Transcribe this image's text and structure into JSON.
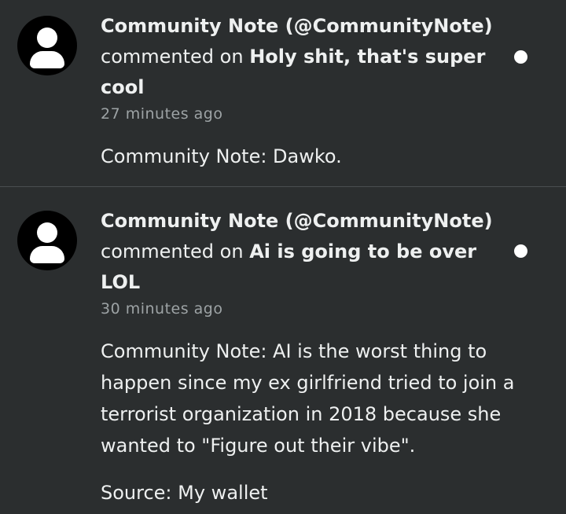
{
  "notifications": [
    {
      "author": "Community Note (@CommunityNote)",
      "action": "commented on",
      "post_title": "Holy shit, that's super cool",
      "timestamp": "27 minutes ago",
      "body": "Community Note: Dawko.",
      "unread": true
    },
    {
      "author": "Community Note (@CommunityNote)",
      "action": "commented on",
      "post_title": "Ai is going to be over LOL",
      "timestamp": "30 minutes ago",
      "body": "Community Note: AI is the worst thing to happen since my ex girlfriend tried to join a terrorist organization in 2018 because she wanted to \"Figure out their vibe\".",
      "source": "Source: My wallet",
      "unread": true
    }
  ],
  "colors": {
    "background": "#2b2e2f",
    "text": "#eef0f0",
    "muted": "#9da3a5",
    "divider": "#4a4e50",
    "avatar": "#000000",
    "unread_dot": "#ffffff"
  },
  "icons": {
    "avatar": "default-user-avatar-icon",
    "unread": "unread-dot-icon"
  }
}
